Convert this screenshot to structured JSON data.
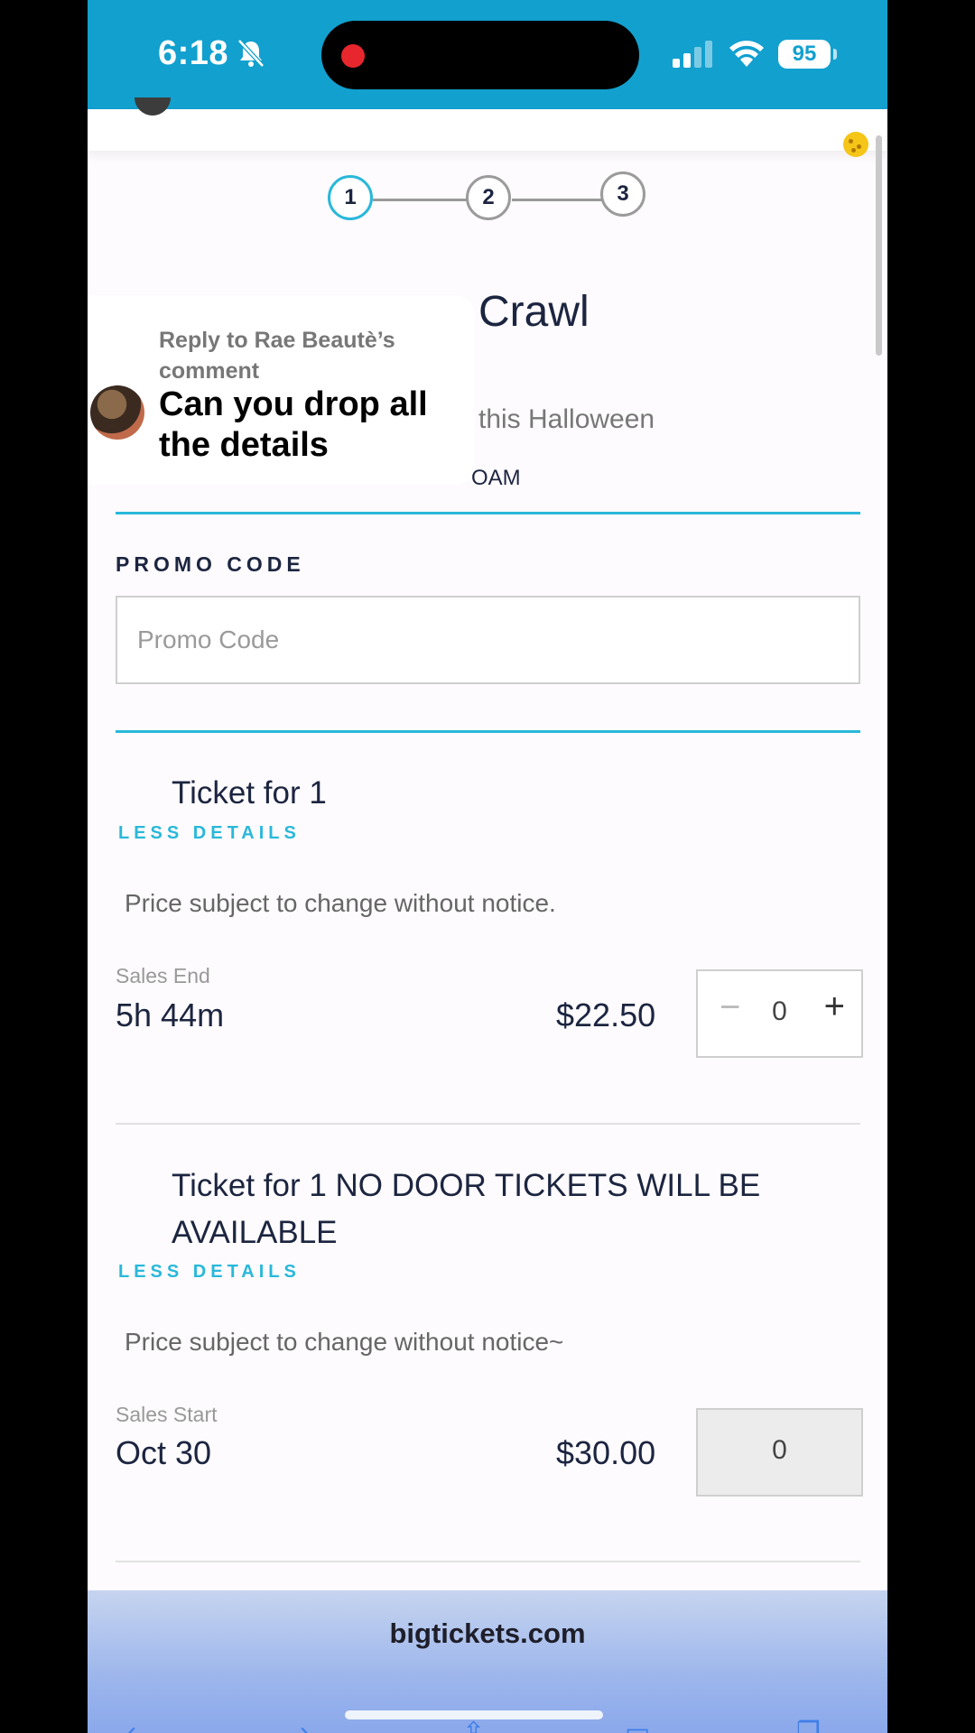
{
  "status_bar": {
    "time": "6:18",
    "battery": "95"
  },
  "stepper": {
    "steps": [
      "1",
      "2",
      "3"
    ],
    "active": 1
  },
  "event": {
    "title_fragment": "Crawl",
    "subtitle_fragment": "this Halloween",
    "time_fragment": "OAM"
  },
  "comment_bubble": {
    "reply_to": "Reply to Rae Beautè’s comment",
    "text": "Can you drop all the details"
  },
  "promo": {
    "label": "PROMO CODE",
    "placeholder": "Promo Code"
  },
  "tickets": [
    {
      "name": "Ticket for 1",
      "details_toggle": "LESS DETAILS",
      "note": "Price subject to change without notice.",
      "sales_label": "Sales End",
      "sales_value": "5h 44m",
      "price": "$22.50",
      "quantity": "0",
      "minus": "−",
      "plus": "+"
    },
    {
      "name": "Ticket for 1 NO DOOR TICKETS WILL BE AVAILABLE",
      "details_toggle": "LESS DETAILS",
      "note": "Price subject to change without notice~",
      "sales_label": "Sales Start",
      "sales_value": "Oct 30",
      "price": "$30.00",
      "quantity": "0"
    }
  ],
  "browser": {
    "url": "bigtickets.com"
  },
  "colors": {
    "status_bar": "#12a0cf",
    "accent": "#29b8da",
    "text_dark": "#1c2540"
  }
}
